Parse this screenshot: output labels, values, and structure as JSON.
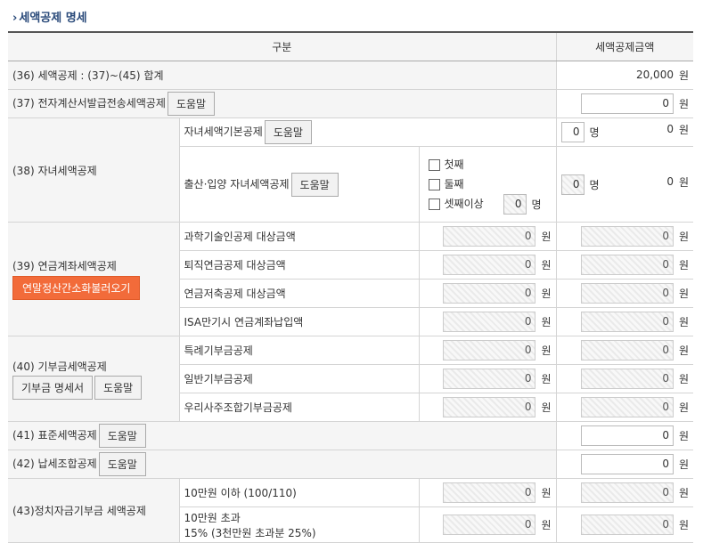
{
  "section_title": "세액공제 명세",
  "header": {
    "col1": "구분",
    "col2": "세액공제금액"
  },
  "help": "도움말",
  "won": "원",
  "myeong": "명",
  "rows": {
    "r36": {
      "label": "(36) 세액공제 : (37)~(45) 합계",
      "amount": "20,000"
    },
    "r37": {
      "label": "(37) 전자계산서발급전송세액공제",
      "amount": "0"
    },
    "r38": {
      "label": "(38) 자녀세액공제",
      "basic": {
        "label": "자녀세액기본공제",
        "count": "0",
        "amount": "0"
      },
      "birth": {
        "label": "출산·입양 자녀세액공제",
        "count": "0",
        "amount": "0",
        "checks": [
          "첫째",
          "둘째",
          "셋째이상"
        ],
        "third_count": "0"
      }
    },
    "r39": {
      "label": "(39) 연금계좌세액공제",
      "load_btn": "연말정산간소화불러오기",
      "items": [
        {
          "label": "과학기술인공제 대상금액",
          "base": "0",
          "amount": "0"
        },
        {
          "label": "퇴직연금공제 대상금액",
          "base": "0",
          "amount": "0"
        },
        {
          "label": "연금저축공제 대상금액",
          "base": "0",
          "amount": "0"
        },
        {
          "label": "ISA만기시 연금계좌납입액",
          "base": "0",
          "amount": "0"
        }
      ]
    },
    "r40": {
      "label": "(40) 기부금세액공제",
      "detail_btn": "기부금 명세서",
      "items": [
        {
          "label": "특례기부금공제",
          "base": "0",
          "amount": "0"
        },
        {
          "label": "일반기부금공제",
          "base": "0",
          "amount": "0"
        },
        {
          "label": "우리사주조합기부금공제",
          "base": "0",
          "amount": "0"
        }
      ]
    },
    "r41": {
      "label": "(41) 표준세액공제",
      "amount": "0"
    },
    "r42": {
      "label": "(42) 납세조합공제",
      "amount": "0"
    },
    "r43": {
      "label": "(43)정치자금기부금 세액공제",
      "items": [
        {
          "label": "10만원 이하 (100/110)",
          "base": "0",
          "amount": "0"
        },
        {
          "label1": "10만원 초과",
          "label2": "15% (3천만원 초과분 25%)",
          "base": "0",
          "amount": "0"
        }
      ]
    }
  }
}
